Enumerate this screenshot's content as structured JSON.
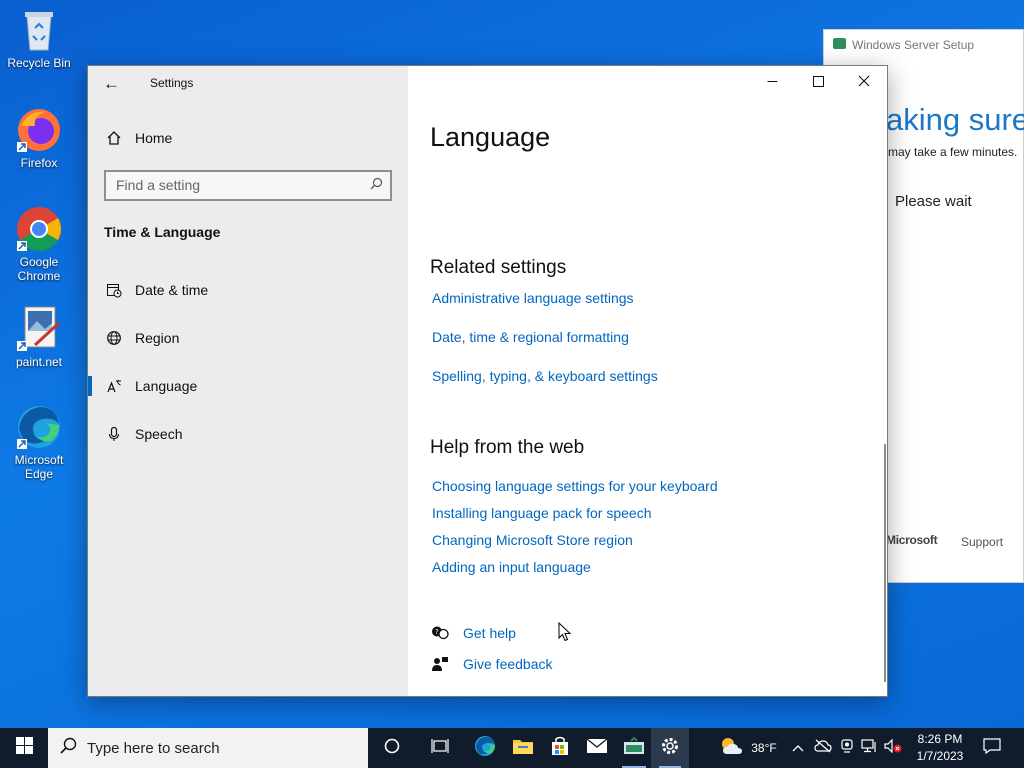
{
  "desktop": {
    "icons": [
      {
        "label": "Recycle Bin"
      },
      {
        "label": "Firefox"
      },
      {
        "label": "Google Chrome"
      },
      {
        "label": "paint.net"
      },
      {
        "label": "Microsoft Edge"
      }
    ]
  },
  "setup_window": {
    "title": "Windows Server Setup",
    "heading": "aking sure",
    "subtext": "may take a few minutes.",
    "wait_text": "Please wait",
    "footer_brand": "Microsoft",
    "footer_support": "Support"
  },
  "settings": {
    "app_title": "Settings",
    "nav": {
      "home_label": "Home",
      "search_placeholder": "Find a setting",
      "section_title": "Time & Language",
      "items": [
        {
          "label": "Date & time",
          "icon": "calendar-clock-icon"
        },
        {
          "label": "Region",
          "icon": "globe-icon"
        },
        {
          "label": "Language",
          "icon": "language-icon",
          "active": true
        },
        {
          "label": "Speech",
          "icon": "microphone-icon"
        }
      ]
    },
    "content": {
      "page_title": "Language",
      "related_title": "Related settings",
      "related_links": [
        "Administrative language settings",
        "Date, time & regional formatting",
        "Spelling, typing, & keyboard settings"
      ],
      "help_title": "Help from the web",
      "help_links": [
        "Choosing language settings for your keyboard",
        "Installing language pack for speech",
        "Changing Microsoft Store region",
        "Adding an input language"
      ],
      "get_help": "Get help",
      "give_feedback": "Give feedback"
    }
  },
  "taskbar": {
    "search_placeholder": "Type here to search",
    "weather": "38°F",
    "time": "8:26 PM",
    "date": "1/7/2023"
  },
  "colors": {
    "accent": "#0067c0",
    "nav_bg": "#ececec",
    "taskbar_bg": "#101c2c"
  }
}
